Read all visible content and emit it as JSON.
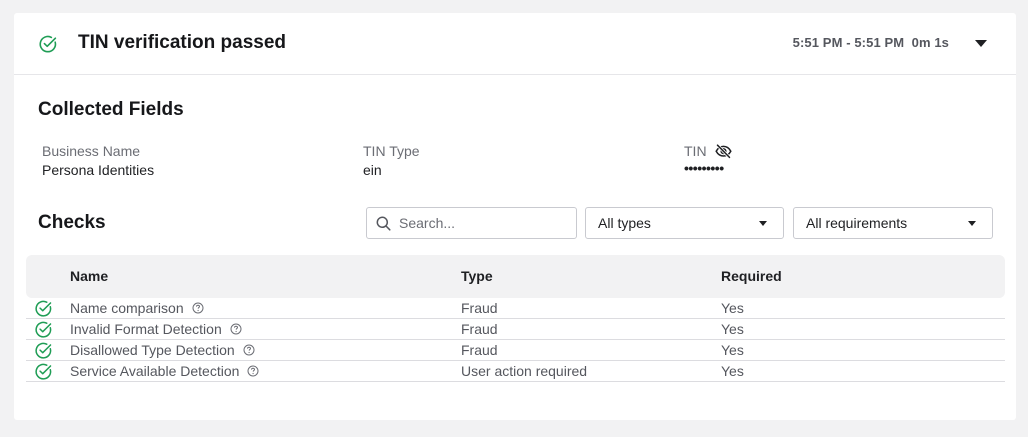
{
  "header": {
    "title": "TIN verification passed",
    "time_range": "5:51 PM - 5:51 PM",
    "duration": "0m 1s",
    "status_color": "#1f9d55"
  },
  "collected_fields": {
    "title": "Collected Fields",
    "fields": [
      {
        "label": "Business Name",
        "value": "Persona Identities"
      },
      {
        "label": "TIN Type",
        "value": "ein"
      },
      {
        "label": "TIN",
        "value": "•••••••••"
      }
    ]
  },
  "checks": {
    "title": "Checks",
    "search_placeholder": "Search...",
    "type_filter": "All types",
    "requirement_filter": "All requirements",
    "columns": {
      "name": "Name",
      "type": "Type",
      "required": "Required"
    },
    "rows": [
      {
        "name": "Name comparison",
        "type": "Fraud",
        "required": "Yes"
      },
      {
        "name": "Invalid Format Detection",
        "type": "Fraud",
        "required": "Yes"
      },
      {
        "name": "Disallowed Type Detection",
        "type": "Fraud",
        "required": "Yes"
      },
      {
        "name": "Service Available Detection",
        "type": "User action required",
        "required": "Yes"
      }
    ]
  }
}
